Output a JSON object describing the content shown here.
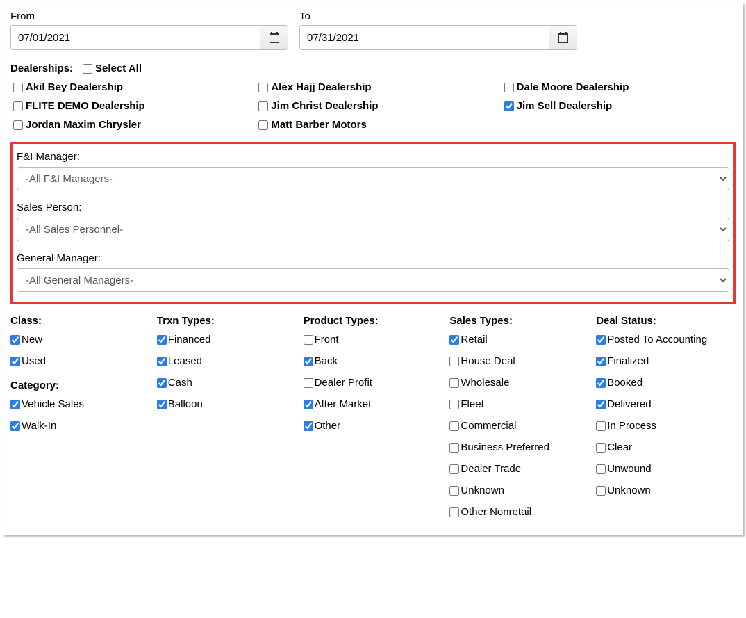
{
  "dates": {
    "from_label": "From",
    "to_label": "To",
    "from_value": "07/01/2021",
    "to_value": "07/31/2021"
  },
  "dealerships": {
    "label": "Dealerships:",
    "select_all": "Select All",
    "items": [
      {
        "label": "Akil Bey Dealership",
        "checked": false
      },
      {
        "label": "Alex Hajj Dealership",
        "checked": false
      },
      {
        "label": "Dale Moore Dealership",
        "checked": false
      },
      {
        "label": "FLITE DEMO Dealership",
        "checked": false
      },
      {
        "label": "Jim Christ Dealership",
        "checked": false
      },
      {
        "label": "Jim Sell Dealership",
        "checked": true
      },
      {
        "label": "Jordan Maxim Chrysler",
        "checked": false
      },
      {
        "label": "Matt Barber Motors",
        "checked": false
      }
    ]
  },
  "managers": {
    "fi_label": "F&I Manager:",
    "fi_value": "-All F&I Managers-",
    "sales_label": "Sales Person:",
    "sales_value": "-All Sales Personnel-",
    "gm_label": "General Manager:",
    "gm_value": "-All General Managers-"
  },
  "filters": {
    "class": {
      "heading": "Class:",
      "items": [
        {
          "label": "New",
          "checked": true
        },
        {
          "label": "Used",
          "checked": true
        }
      ]
    },
    "category": {
      "heading": "Category:",
      "items": [
        {
          "label": "Vehicle Sales",
          "checked": true
        },
        {
          "label": "Walk-In",
          "checked": true
        }
      ]
    },
    "trxn": {
      "heading": "Trxn Types:",
      "items": [
        {
          "label": "Financed",
          "checked": true
        },
        {
          "label": "Leased",
          "checked": true
        },
        {
          "label": "Cash",
          "checked": true
        },
        {
          "label": "Balloon",
          "checked": true
        }
      ]
    },
    "product": {
      "heading": "Product Types:",
      "items": [
        {
          "label": "Front",
          "checked": false
        },
        {
          "label": "Back",
          "checked": true
        },
        {
          "label": "Dealer Profit",
          "checked": false
        },
        {
          "label": "After Market",
          "checked": true
        },
        {
          "label": "Other",
          "checked": true
        }
      ]
    },
    "sales": {
      "heading": "Sales Types:",
      "items": [
        {
          "label": "Retail",
          "checked": true
        },
        {
          "label": "House Deal",
          "checked": false
        },
        {
          "label": "Wholesale",
          "checked": false
        },
        {
          "label": "Fleet",
          "checked": false
        },
        {
          "label": "Commercial",
          "checked": false
        },
        {
          "label": "Business Preferred",
          "checked": false
        },
        {
          "label": "Dealer Trade",
          "checked": false
        },
        {
          "label": "Unknown",
          "checked": false
        },
        {
          "label": "Other Nonretail",
          "checked": false
        }
      ]
    },
    "deal": {
      "heading": "Deal Status:",
      "items": [
        {
          "label": "Posted To Accounting",
          "checked": true
        },
        {
          "label": "Finalized",
          "checked": true
        },
        {
          "label": "Booked",
          "checked": true
        },
        {
          "label": "Delivered",
          "checked": true
        },
        {
          "label": "In Process",
          "checked": false
        },
        {
          "label": "Clear",
          "checked": false
        },
        {
          "label": "Unwound",
          "checked": false
        },
        {
          "label": "Unknown",
          "checked": false
        }
      ]
    }
  }
}
